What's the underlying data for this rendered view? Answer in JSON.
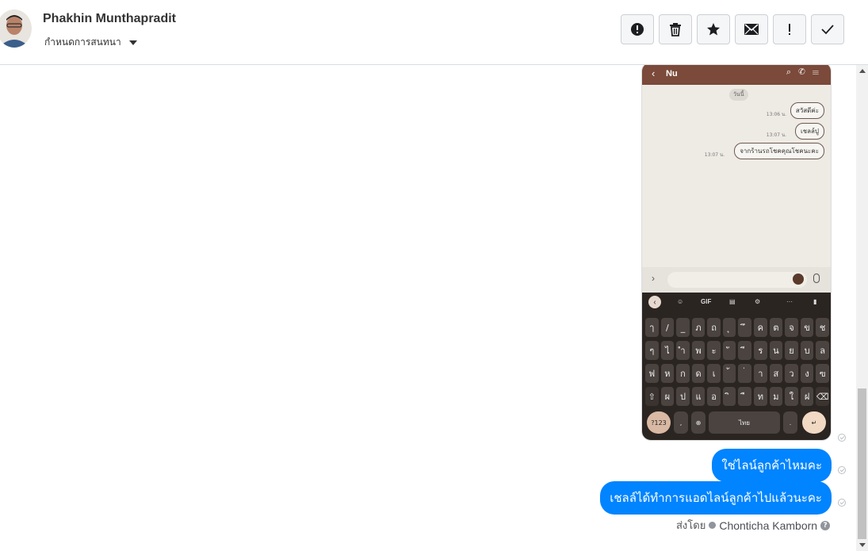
{
  "header": {
    "contact_name": "Phakhin Munthapradit",
    "conversation_setting": "กำหนดการสนทนา",
    "toolbar": [
      {
        "name": "spam-button",
        "icon": "alert-circle-icon"
      },
      {
        "name": "delete-button",
        "icon": "trash-icon"
      },
      {
        "name": "star-button",
        "icon": "star-icon"
      },
      {
        "name": "mark-unread-button",
        "icon": "envelope-icon"
      },
      {
        "name": "important-button",
        "icon": "exclamation-icon"
      },
      {
        "name": "done-button",
        "icon": "check-icon"
      }
    ]
  },
  "screenshot": {
    "chat_title": "Nu",
    "day_label": "วันนี้",
    "bubbles": [
      {
        "text": "สวัสดีค่ะ",
        "time": "13:06 น."
      },
      {
        "text": "เชลล์ปู",
        "time": "13:07 น."
      },
      {
        "text": "จากร้านรถโชคคุณโชคนะคะ",
        "time": "13:07 น."
      }
    ],
    "keyboard": {
      "toolbar": [
        "GIF"
      ],
      "row1": [
        "ๅ",
        "/",
        "_",
        "ภ",
        "ถ",
        "ุ",
        "ึ",
        "ค",
        "ต",
        "จ",
        "ข",
        "ช"
      ],
      "row2": [
        "ๆ",
        "ไ",
        "ำ",
        "พ",
        "ะ",
        "ั",
        "ี",
        "ร",
        "น",
        "ย",
        "บ",
        "ล"
      ],
      "row3": [
        "ฟ",
        "ห",
        "ก",
        "ด",
        "เ",
        "้",
        "่",
        "า",
        "ส",
        "ว",
        "ง",
        "ฃ"
      ],
      "row4": [
        "⇧",
        "ผ",
        "ป",
        "แ",
        "อ",
        "ิ",
        "ื",
        "ท",
        "ม",
        "ใ",
        "ฝ",
        "⌫"
      ],
      "mode_key": "?123",
      "space_label": "ไทย",
      "period": "."
    }
  },
  "messages": [
    {
      "text": "ใช่ไลน์ลูกค้าไหมคะ"
    },
    {
      "text": "เชลล์ได้ทำการแอดไลน์ลูกค้าไปแล้วนะคะ"
    }
  ],
  "sent_by": {
    "label": "ส่งโดย",
    "agent": "Chonticha Kamborn"
  },
  "colors": {
    "message_bubble": "#0084ff",
    "line_header": "#7b4a3a"
  }
}
